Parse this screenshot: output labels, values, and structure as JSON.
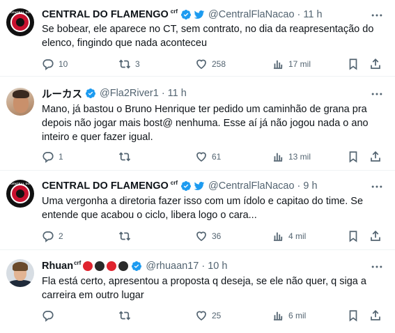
{
  "tweets": [
    {
      "name": "CENTRAL DO FLAMENGO",
      "sup": "crf",
      "handle": "@CentralFlaNacao",
      "time": "11 h",
      "text": "Se bobear, ele aparece no CT, sem contrato, no dia da reapresentação do elenco, fingindo que nada aconteceu",
      "replies": "10",
      "retweets": "3",
      "likes": "258",
      "views": "17 mil",
      "avatar_text": "CENTRAL DO"
    },
    {
      "name": "ルーカス",
      "handle": "@Fla2River1",
      "time": "11 h",
      "text": "Mano, já bastou o Bruno Henrique ter pedido um caminhão de grana pra depois não jogar mais bost@ nenhuma. Esse aí já não jogou nada o ano inteiro e quer fazer igual.",
      "replies": "1",
      "retweets": "",
      "likes": "61",
      "views": "13 mil"
    },
    {
      "name": "CENTRAL DO FLAMENGO",
      "sup": "crf",
      "handle": "@CentralFlaNacao",
      "time": "9 h",
      "text": "Uma vergonha a diretoria fazer isso com um ídolo  e capitao do time. Se entende que acabou o ciclo, libera logo o cara...",
      "replies": "2",
      "retweets": "",
      "likes": "36",
      "views": "4 mil",
      "avatar_text": "CENTRAL DO"
    },
    {
      "name": "Rhuan",
      "sup": "crf",
      "handle": "@rhuaan17",
      "time": "10 h",
      "text": "Fla está certo, apresentou a proposta q deseja, se ele não quer, q siga a carreira em outro lugar",
      "replies": "",
      "retweets": "",
      "likes": "25",
      "views": "6 mil"
    }
  ],
  "colors": {
    "verified": "#1d9bf0",
    "text": "#0f1419",
    "secondary": "#536471",
    "flamengo_red": "#e0242f",
    "dark_ball": "#2a2a2a"
  },
  "icons": [
    "reply-icon",
    "retweet-icon",
    "like-icon",
    "views-icon",
    "bookmark-icon",
    "share-icon",
    "more-icon",
    "verified-badge-icon",
    "twitter-bird-icon"
  ]
}
